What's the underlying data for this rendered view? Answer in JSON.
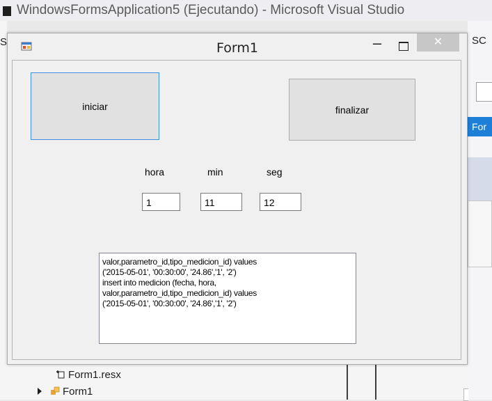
{
  "vs": {
    "title": "WindowsFormsApplication5 (Ejecutando) - Microsoft Visual Studio",
    "left_fragments": [
      "S"
    ],
    "right_panel": {
      "top_label": "SC",
      "tab_label": "For"
    },
    "solution_explorer": {
      "items": [
        {
          "label": "Form1.resx",
          "icon": "resource-file-icon"
        },
        {
          "label": "Form1",
          "icon": "form-class-icon"
        }
      ]
    }
  },
  "form": {
    "title": "Form1",
    "controls": {
      "minimize": "–",
      "close": "✕"
    },
    "buttons": {
      "iniciar": "iniciar",
      "finalizar": "finalizar"
    },
    "time": {
      "hora_label": "hora",
      "min_label": "min",
      "seg_label": "seg",
      "hora_value": "1",
      "min_value": "11",
      "seg_value": "12"
    },
    "sql_text": "valor,parametro_id,tipo_medicion_id) values\n('2015-05-01', '00:30:00', '24.86','1', '2')\ninsert into medicion (fecha, hora,\nvalor,parametro_id,tipo_medicion_id) values\n('2015-05-01', '00:30:00', '24.86','1', '2')"
  },
  "colors": {
    "accent_blue": "#1e7fd8",
    "focus_border": "#3c8ee6",
    "close_button_bg": "#c7c7c7"
  }
}
